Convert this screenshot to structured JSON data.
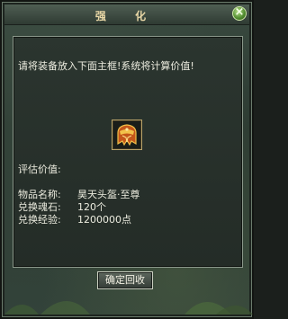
{
  "window": {
    "title": "强 化"
  },
  "instruction": "请将装备放入下面主框!系统将计算价值!",
  "item": {
    "icon": "golden-helmet-icon"
  },
  "valuation": {
    "label": "评估价值:",
    "rows": [
      {
        "label": "物品名称:",
        "value": "昊天头盔·至尊"
      },
      {
        "label": "兑换魂石:",
        "value": "120个"
      },
      {
        "label": "兑换经验:",
        "value": "1200000点"
      }
    ]
  },
  "buttons": {
    "confirm_recycle": "确定回收"
  },
  "colors": {
    "title": "#e8d7a6",
    "text": "#ececdf",
    "close": "#4f8a2e"
  }
}
